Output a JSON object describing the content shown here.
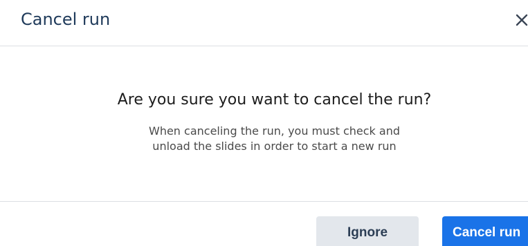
{
  "dialog": {
    "title": "Cancel run",
    "close_icon": "close-icon",
    "question": "Are you sure you want to cancel the run?",
    "description_line1": "When canceling the run, you must check and",
    "description_line2": "unload the slides in order to start a new run",
    "buttons": {
      "ignore_label": "Ignore",
      "cancel_run_label": "Cancel run"
    }
  },
  "colors": {
    "title": "#1f3a5a",
    "primary_button": "#1a73e8",
    "secondary_button": "#e3e7ec",
    "divider": "#dcdfe3"
  }
}
